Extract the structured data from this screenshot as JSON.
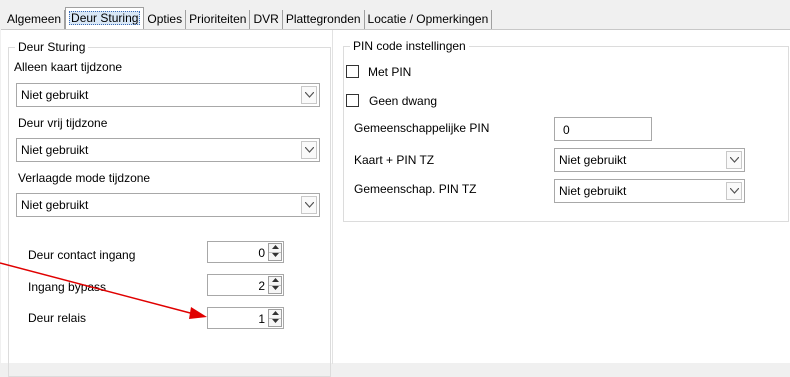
{
  "tabs": [
    {
      "label": "Algemeen",
      "active": false
    },
    {
      "label": "Deur Sturing",
      "active": true
    },
    {
      "label": "Opties",
      "active": false
    },
    {
      "label": "Prioriteiten",
      "active": false
    },
    {
      "label": "DVR",
      "active": false
    },
    {
      "label": "Plattegronden",
      "active": false
    },
    {
      "label": "Locatie / Opmerkingen",
      "active": false
    }
  ],
  "door_control": {
    "legend": "Deur Sturing",
    "card_only_label": "Alleen kaart tijdzone",
    "card_only_value": "Niet gebruikt",
    "door_free_label": "Deur vrij tijdzone",
    "door_free_value": "Niet gebruikt",
    "reduced_mode_label": "Verlaagde mode tijdzone",
    "reduced_mode_value": "Niet gebruikt",
    "door_contact_label": "Deur contact ingang",
    "door_contact_value": "0",
    "input_bypass_label": "Ingang bypass",
    "input_bypass_value": "2",
    "door_relay_label": "Deur relais",
    "door_relay_value": "1"
  },
  "pin_settings": {
    "legend": "PIN code instellingen",
    "with_pin_label": "Met PIN",
    "with_pin_checked": false,
    "no_duress_label": "Geen dwang",
    "no_duress_checked": false,
    "common_pin_label": "Gemeenschappelijke PIN",
    "common_pin_value": "0",
    "card_pin_tz_label": "Kaart + PIN TZ",
    "card_pin_tz_value": "Niet gebruikt",
    "common_pin_tz_label": "Gemeenschap. PIN TZ",
    "common_pin_tz_value": "Niet gebruikt"
  },
  "colors": {
    "annotation_arrow": "#e00000",
    "active_tab_focus": "#3a6ab5"
  }
}
